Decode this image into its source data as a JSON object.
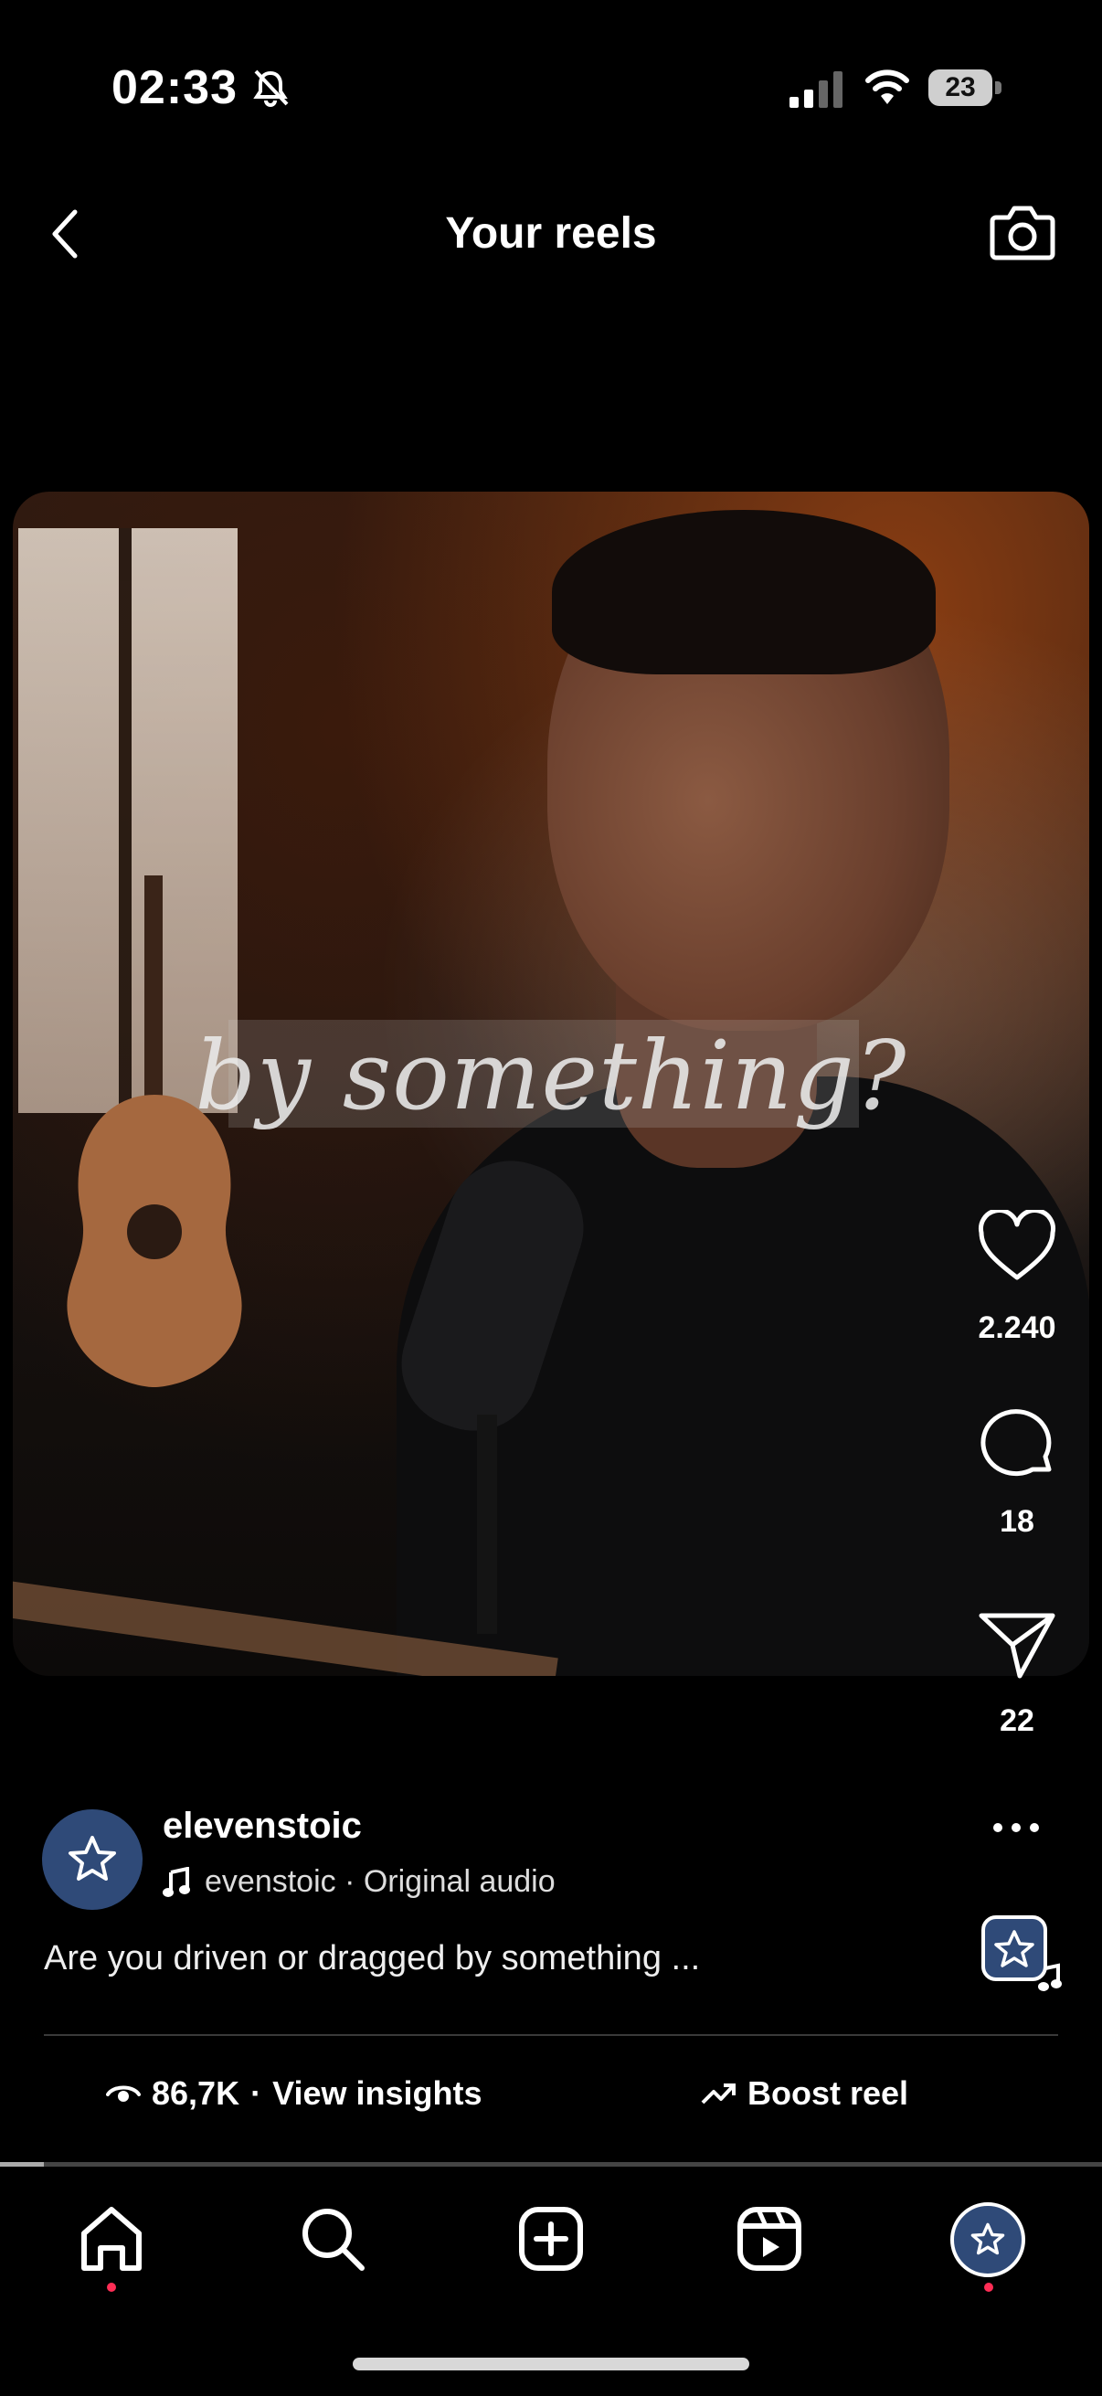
{
  "status_bar": {
    "time": "02:33",
    "battery": "23"
  },
  "header": {
    "title": "Your reels"
  },
  "reel": {
    "overlay_text": "by something?"
  },
  "actions": {
    "likes": "2.240",
    "comments": "18",
    "shares": "22"
  },
  "author": {
    "username": "elevenstoic",
    "audio": "evenstoic · Original audio",
    "caption": "Are you driven or dragged by something ..."
  },
  "insights": {
    "views": "86,7K",
    "separator": "·",
    "link_label": "View insights",
    "boost_label": "Boost reel"
  },
  "progress": {
    "fraction": 0.04
  },
  "colors": {
    "background": "#000000",
    "avatar": "#2f4a78",
    "notification_dot": "#ff2d55"
  }
}
